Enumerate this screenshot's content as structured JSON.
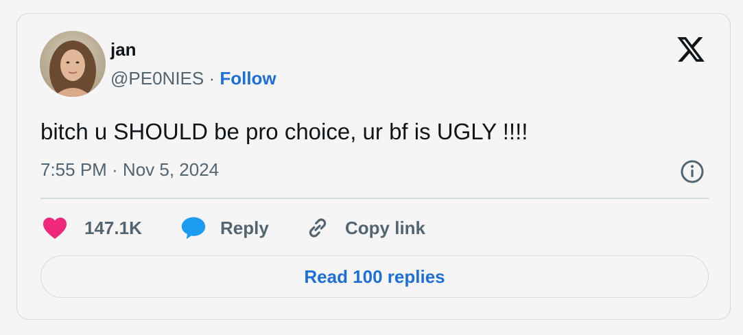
{
  "author": {
    "name": "jan",
    "handle": "@PE0NIES",
    "separator": " · ",
    "follow_label": "Follow",
    "avatar_icon": "profile-photo"
  },
  "tweet": {
    "text": "bitch u SHOULD be pro choice, ur bf is UGLY !!!!",
    "timestamp": "7:55 PM · Nov 5, 2024"
  },
  "actions": {
    "like_count": "147.1K",
    "reply_label": "Reply",
    "copy_link_label": "Copy link"
  },
  "read_replies_label": "Read 100 replies",
  "colors": {
    "accent": "#1d6fd6",
    "like": "#f0287a",
    "muted": "#536471",
    "text": "#0f1419",
    "border": "#cfd9de"
  },
  "icons": {
    "brand": "x-logo-icon",
    "info": "info-icon",
    "like": "heart-icon",
    "reply": "speech-bubble-icon",
    "copy": "link-icon"
  }
}
